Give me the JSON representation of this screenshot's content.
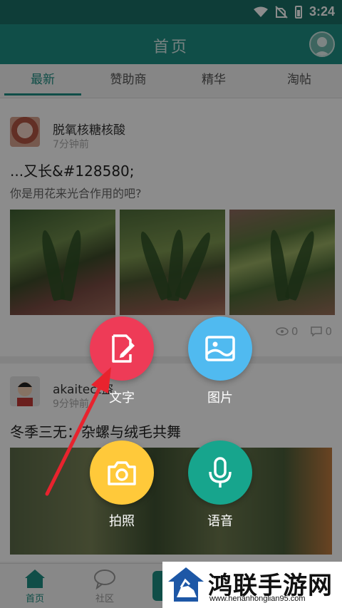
{
  "status": {
    "time": "3:24"
  },
  "header": {
    "title": "首页"
  },
  "tabs": [
    {
      "label": "最新",
      "active": true
    },
    {
      "label": "赞助商",
      "active": false
    },
    {
      "label": "精华",
      "active": false
    },
    {
      "label": "淘帖",
      "active": false
    }
  ],
  "posts": [
    {
      "user": "脱氧核糖核酸",
      "time": "7分钟前",
      "title": "...又长&#128580;",
      "text": "你是用花来光合作用的吧?",
      "views": "0",
      "comments": "0"
    },
    {
      "user": "akaitect盗",
      "time": "9分钟前",
      "title": "冬季三无：杂螺与绒毛共舞"
    }
  ],
  "actions": {
    "text": "文字",
    "image": "图片",
    "photo": "拍照",
    "voice": "语音"
  },
  "nav": {
    "home": "首页",
    "community": "社区"
  },
  "watermark": {
    "title": "鸿联手游网",
    "url": "www.henanhonglian95.com"
  },
  "colors": {
    "primary": "#1e8e83",
    "text_action": "#ee3b57",
    "image_action": "#50baf0",
    "photo_action": "#ffc93a",
    "voice_action": "#17a58d",
    "arrow": "#e8232e"
  }
}
